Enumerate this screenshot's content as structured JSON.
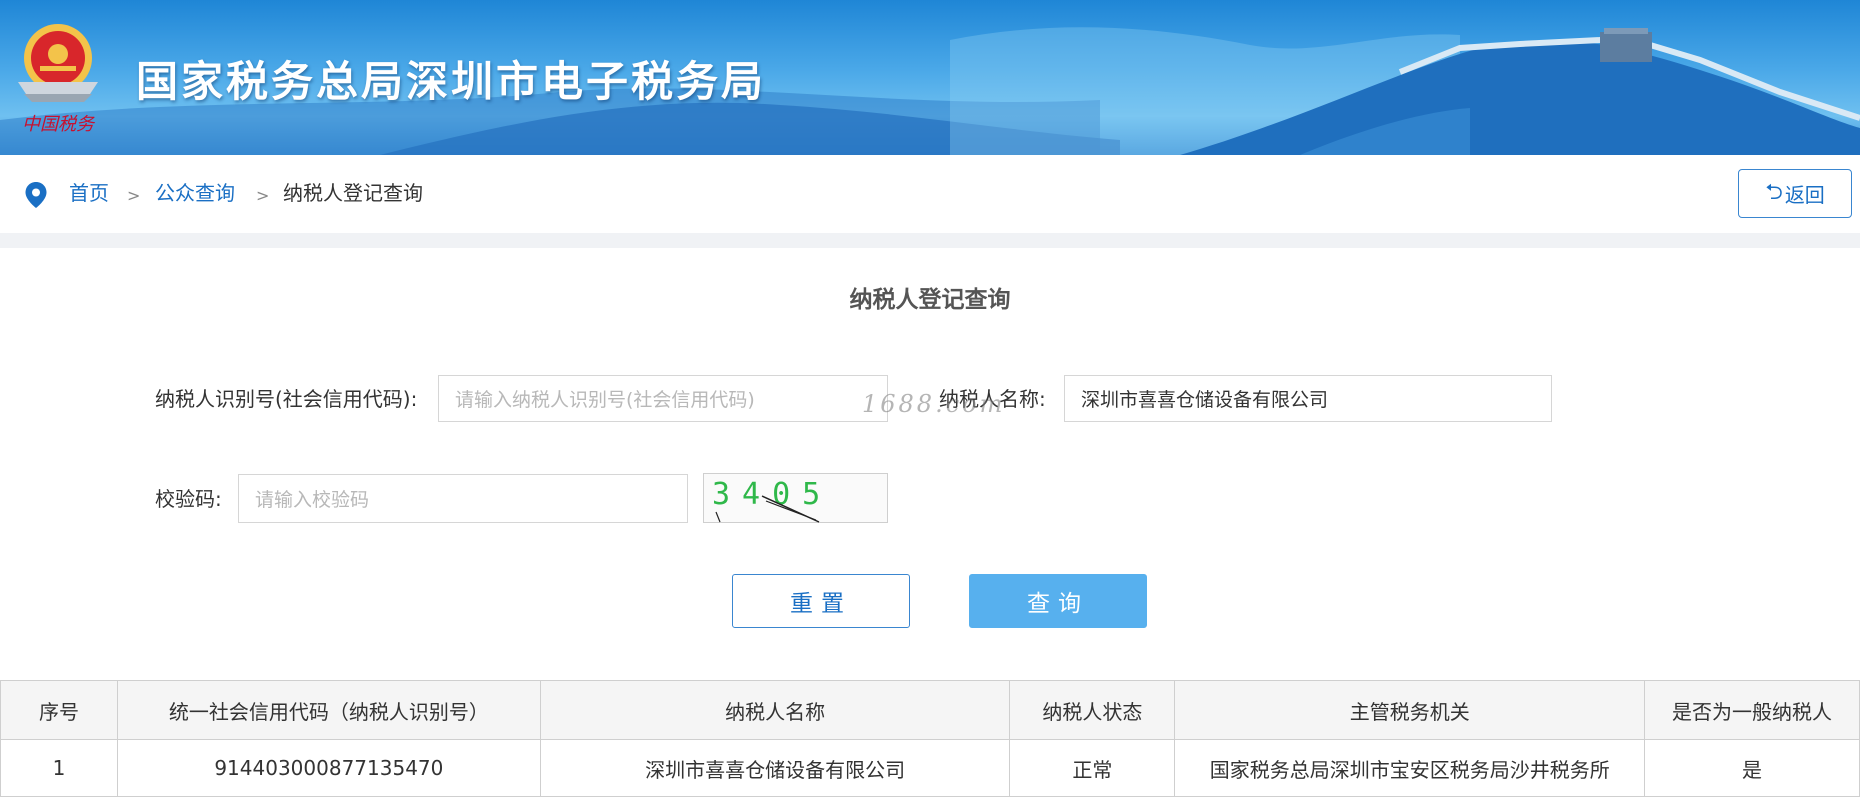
{
  "header": {
    "site_title": "国家税务总局深圳市电子税务局",
    "emblem_icon": "tax-emblem-icon"
  },
  "breadcrumb": {
    "items": [
      {
        "label": "首页"
      },
      {
        "label": "公众查询"
      },
      {
        "label": "纳税人登记查询"
      }
    ],
    "separator": ">",
    "back_label": "返回"
  },
  "form": {
    "title": "纳税人登记查询",
    "taxpayer_id_label": "纳税人识别号(社会信用代码):",
    "taxpayer_id_placeholder": "请输入纳税人识别号(社会信用代码)",
    "taxpayer_id_value": "",
    "taxpayer_name_label": "纳税人名称:",
    "taxpayer_name_value": "深圳市喜喜仓储设备有限公司",
    "verify_label": "校验码:",
    "verify_placeholder": "请输入校验码",
    "captcha_text": "3405",
    "reset_label": "重置",
    "search_label": "查询"
  },
  "watermark": "1688.com",
  "results": {
    "columns": [
      "序号",
      "统一社会信用代码（纳税人识别号）",
      "纳税人名称",
      "纳税人状态",
      "主管税务机关",
      "是否为一般纳税人"
    ],
    "rows": [
      [
        "1",
        "914403000877135470",
        "深圳市喜喜仓储设备有限公司",
        "正常",
        "国家税务总局深圳市宝安区税务局沙井税务所",
        "是"
      ]
    ]
  },
  "colors": {
    "banner_blue": "#2a8fdc",
    "link_blue": "#1a6fc4",
    "search_button": "#57b0ee"
  }
}
